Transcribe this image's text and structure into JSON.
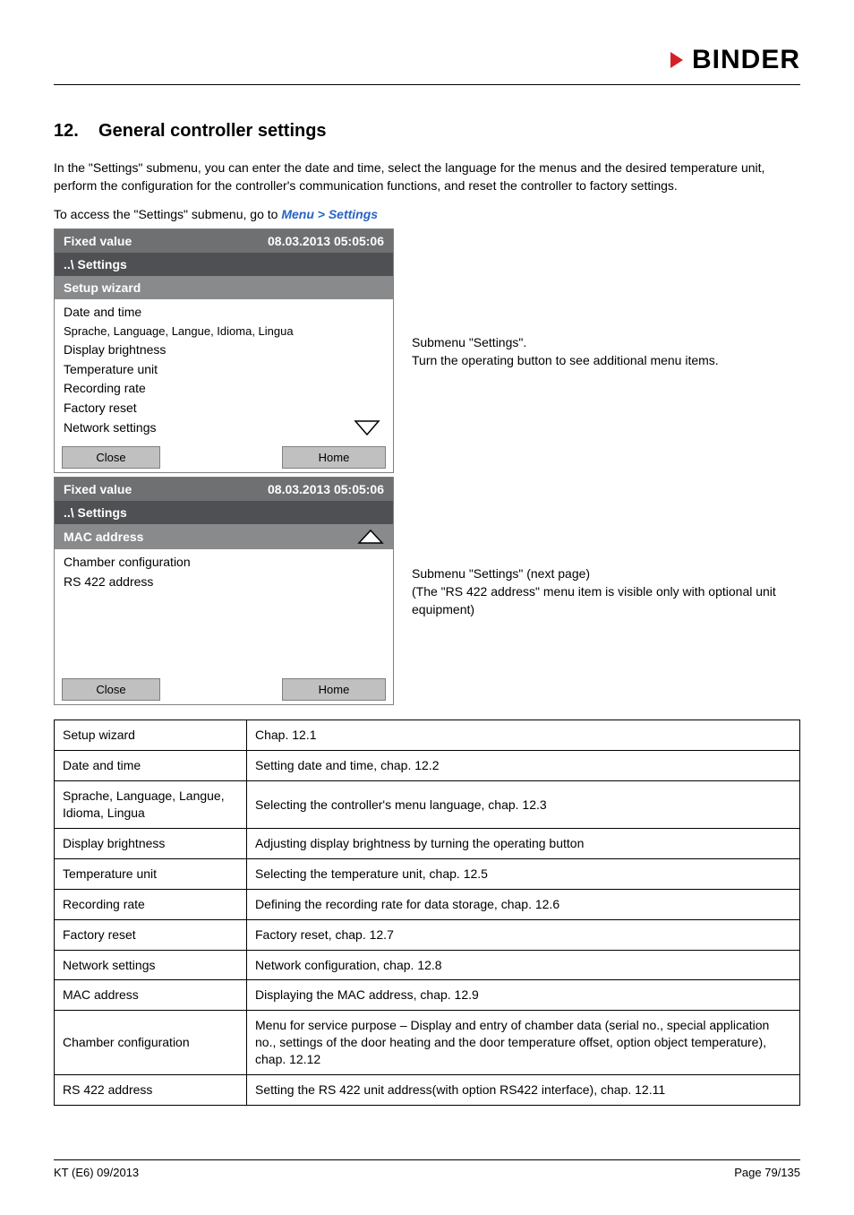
{
  "header": {
    "logo_text": "BINDER"
  },
  "section": {
    "number": "12.",
    "title": "General controller settings"
  },
  "intro": "In the \"Settings\" submenu, you can enter the date and time, select the language for the menus and the desired temperature unit, perform the configuration for the controller's communication functions, and reset the controller to factory settings.",
  "access_prefix": "To access the \"Settings\" submenu, go to ",
  "access_link": "Menu > Settings",
  "screen1": {
    "title": "Fixed value",
    "datetime": "08.03.2013  05:05:06",
    "path": "..\\ Settings",
    "highlight": "Setup wizard",
    "items": [
      "Date and time",
      "Sprache, Language, Langue, Idioma, Lingua",
      "Display brightness",
      "Temperature unit",
      "Recording rate",
      "Factory reset",
      "Network settings"
    ],
    "btn_close": "Close",
    "btn_home": "Home"
  },
  "explain1": {
    "line1": "Submenu \"Settings\".",
    "line2": "Turn the operating button to see additional menu items."
  },
  "screen2": {
    "title": "Fixed value",
    "datetime": "08.03.2013  05:05:06",
    "path": "..\\ Settings",
    "highlight": "MAC address",
    "items": [
      "Chamber configuration",
      "RS 422 address"
    ],
    "btn_close": "Close",
    "btn_home": "Home"
  },
  "explain2": {
    "line1": "Submenu \"Settings\" (next page)",
    "line2": "(The \"RS 422 address\" menu item is visible only with optional unit equipment)"
  },
  "table": [
    {
      "k": "Setup wizard",
      "v": "Chap. 12.1"
    },
    {
      "k": "Date and time",
      "v": "Setting date and time, chap. 12.2"
    },
    {
      "k": "Sprache, Language, Langue, Idioma, Lingua",
      "v": "Selecting the controller's menu language, chap. 12.3"
    },
    {
      "k": "Display brightness",
      "v": "Adjusting display brightness by turning the operating button"
    },
    {
      "k": "Temperature unit",
      "v": "Selecting the temperature unit, chap. 12.5"
    },
    {
      "k": "Recording rate",
      "v": "Defining the recording rate for data storage, chap. 12.6"
    },
    {
      "k": "Factory reset",
      "v": "Factory reset, chap. 12.7"
    },
    {
      "k": "Network settings",
      "v": "Network configuration, chap. 12.8"
    },
    {
      "k": "MAC address",
      "v": "Displaying the MAC address, chap. 12.9"
    },
    {
      "k": "Chamber configuration",
      "v": "Menu for service purpose – Display and entry of chamber data (serial no., special application no., settings of the door heating and the door temperature offset, option object temperature), chap. 12.12"
    },
    {
      "k": "RS 422 address",
      "v": "Setting the RS 422 unit address(with option RS422 interface), chap. 12.11"
    }
  ],
  "footer": {
    "left": "KT (E6) 09/2013",
    "right": "Page 79/135"
  }
}
